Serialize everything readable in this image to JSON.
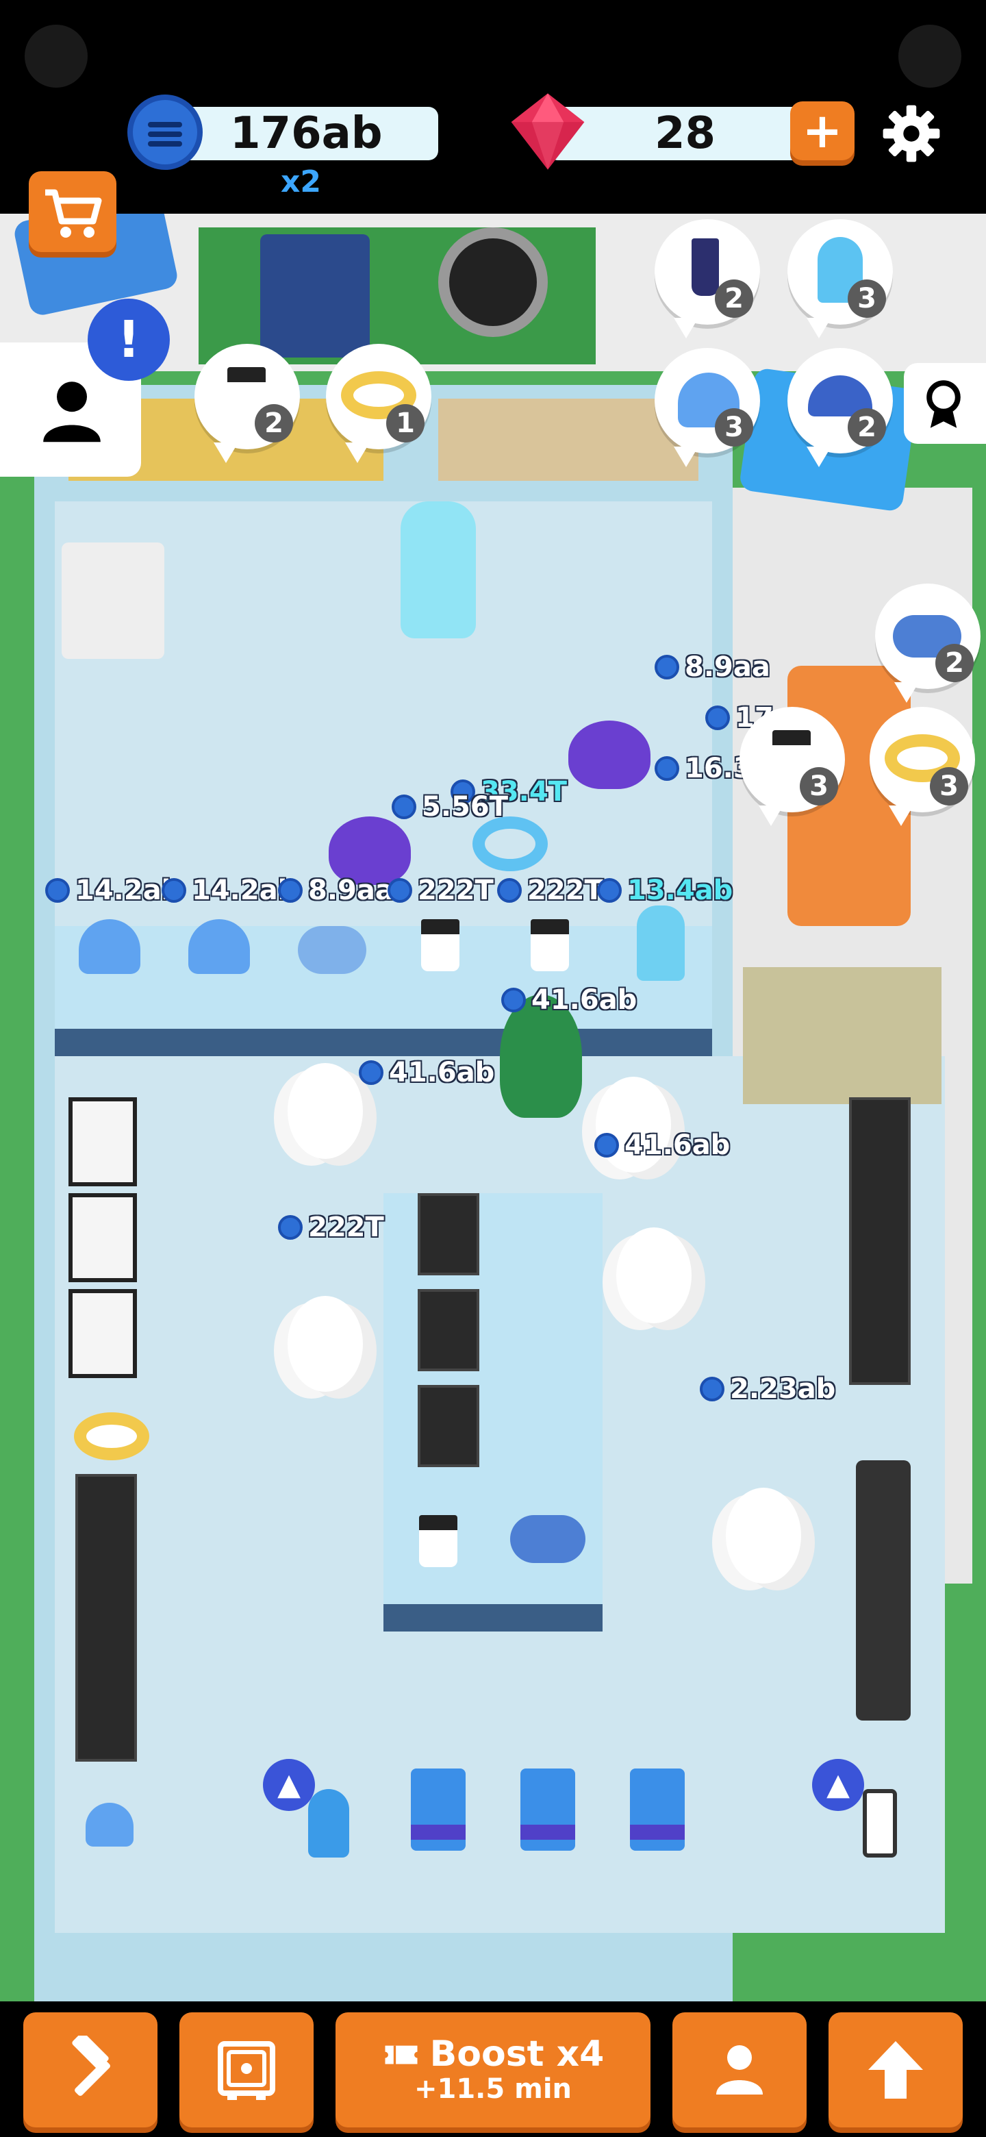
{
  "hud": {
    "coins": "176ab",
    "coin_multiplier": "x2",
    "gems": "28",
    "plus_label": "+"
  },
  "side": {
    "shop_icon": "cart-icon",
    "profile_icon": "person-icon",
    "alert_label": "!",
    "achievements_icon": "ribbon-icon"
  },
  "orders": [
    {
      "item": "milkshake",
      "count": "2"
    },
    {
      "item": "ice-cream",
      "count": "3"
    },
    {
      "item": "coffee",
      "count": "2"
    },
    {
      "item": "donut",
      "count": "1"
    },
    {
      "item": "muffin",
      "count": "3"
    },
    {
      "item": "croissant",
      "count": "2"
    },
    {
      "item": "cookie",
      "count": "2"
    },
    {
      "item": "coffee",
      "count": "3"
    },
    {
      "item": "donut",
      "count": "3"
    }
  ],
  "price_tags": {
    "tag_89aa_top": "8.9aa",
    "tag_17": "17",
    "tag_16": "16.3",
    "tag_334t": "33.4T",
    "tag_556t": "5.56T",
    "tag_142ab_1": "14.2ab",
    "tag_142ab_2": "14.2ab",
    "tag_89aa": "8.9aa",
    "tag_222t_1": "222T",
    "tag_222t_2": "222T",
    "tag_134ab": "13.4ab",
    "tag_416ab_1": "41.6ab",
    "tag_416ab_2": "41.6ab",
    "tag_416ab_3": "41.6ab",
    "tag_222t_3": "222T",
    "tag_223ab": "2.23ab"
  },
  "bottom": {
    "build_icon": "hammer-icon",
    "vault_icon": "safe-icon",
    "boost_title": "Boost x4",
    "boost_sub": "+11.5 min",
    "staff_icon": "person-icon",
    "upgrade_icon": "up-arrow-icon"
  },
  "colors": {
    "orange": "#ef7d22",
    "coin_blue": "#2d6fd6",
    "gem_red": "#e8325a",
    "floor": "#cfe6f0",
    "grass": "#4fae5a"
  }
}
